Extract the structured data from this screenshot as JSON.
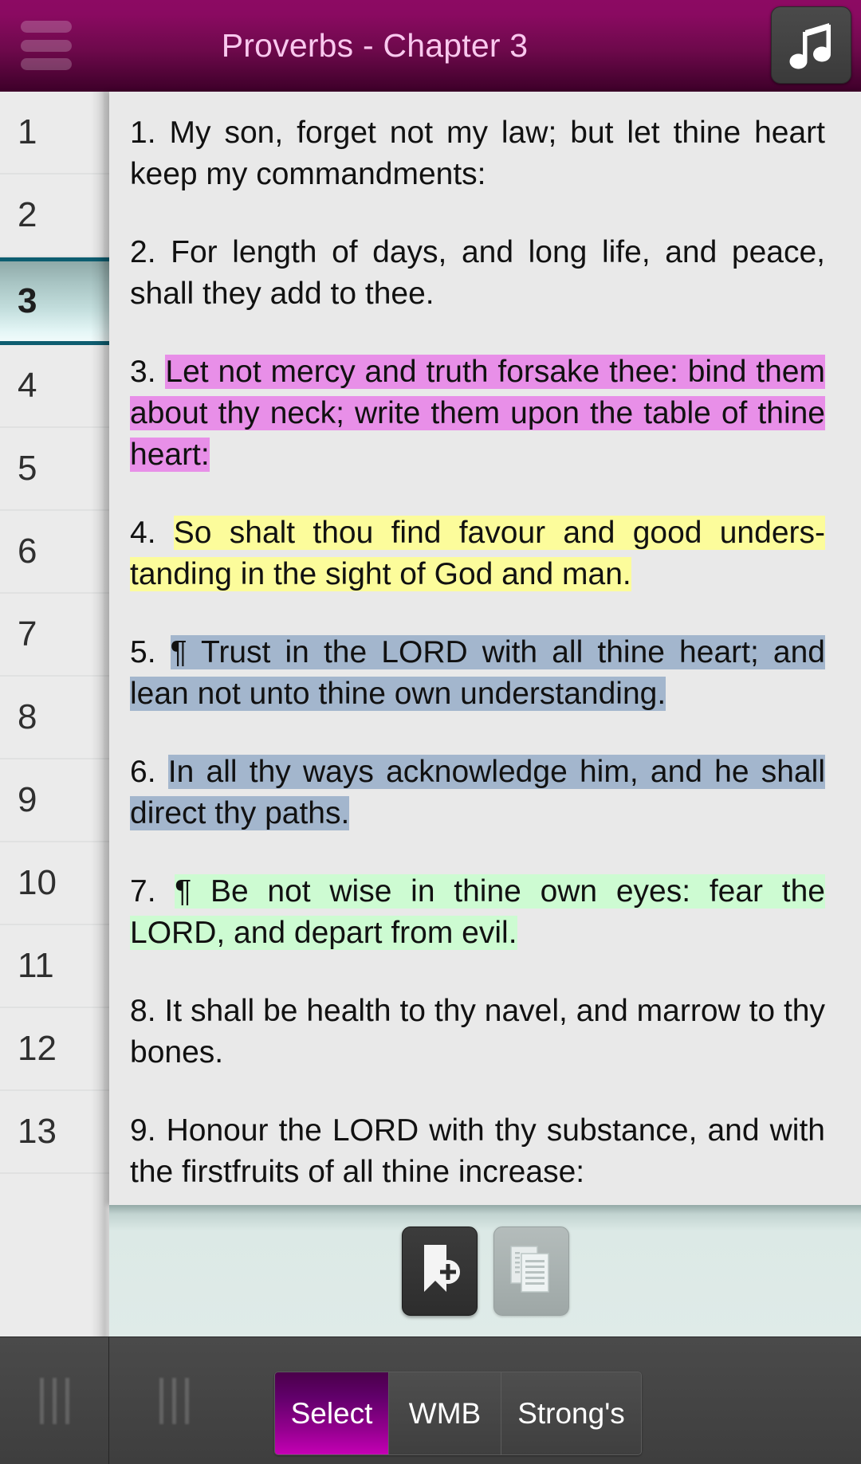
{
  "header": {
    "title": "Proverbs - Chapter 3",
    "menu_icon": "hamburger-menu-icon",
    "music_icon": "music-note-icon",
    "gradient_top": "#8c0a63",
    "gradient_bottom": "#3d0029",
    "title_color": "#f9c8ee"
  },
  "sidebar": {
    "selected_verse": "3",
    "items": [
      {
        "label": "1"
      },
      {
        "label": "2"
      },
      {
        "label": "3"
      },
      {
        "label": "4"
      },
      {
        "label": "5"
      },
      {
        "label": "6"
      },
      {
        "label": "7"
      },
      {
        "label": "8"
      },
      {
        "label": "9"
      },
      {
        "label": "10"
      },
      {
        "label": "11"
      },
      {
        "label": "12"
      },
      {
        "label": "13"
      }
    ]
  },
  "scripture": {
    "verses": [
      {
        "marker": "1. ",
        "text": "My son, forget not my law; but let thine heart keep my commandments:",
        "highlight": "none"
      },
      {
        "marker": "2. ",
        "text": "For length of days, and long life, and peace, shall they add to thee.",
        "highlight": "none"
      },
      {
        "marker": "3. ",
        "text": "Let not mercy and truth forsake thee: bind them about thy neck; write them upon the table of thine heart:",
        "highlight": "pink"
      },
      {
        "marker": "4. ",
        "text": "So shalt thou find favour and good unders-tanding in the sight of God and man.",
        "highlight": "yellow"
      },
      {
        "marker": "5. ",
        "text": "¶ Trust in the LORD with all thine heart; and lean not unto thine own understanding.",
        "highlight": "blue"
      },
      {
        "marker": "6. ",
        "text": "In all thy ways acknowledge him, and he shall direct thy paths.",
        "highlight": "blue"
      },
      {
        "marker": "7. ",
        "text": "¶ Be not wise in thine own eyes: fear the LORD, and depart from evil.",
        "highlight": "green"
      },
      {
        "marker": "8. ",
        "text": "It shall be health to thy navel, and marrow to thy bones.",
        "highlight": "none"
      },
      {
        "marker": "9. ",
        "text": "Honour the LORD with thy substance, and with the firstfruits of all thine increase:",
        "highlight": "none"
      }
    ],
    "highlight_colors": {
      "pink": "#e88fe8",
      "yellow": "#fcfc9b",
      "blue": "#a3b6cd",
      "green": "#cdfbd2"
    }
  },
  "action_bar": {
    "bookmark_icon": "bookmark-add-icon",
    "copy_icon": "copy-pages-icon"
  },
  "bottom_nav": {
    "grip_left_icon": "drag-handle-icon",
    "grip_right_icon": "drag-handle-icon",
    "segments": [
      {
        "label": "Select",
        "active": true
      },
      {
        "label": "WMB",
        "active": false
      },
      {
        "label": "Strong's",
        "active": false
      }
    ],
    "active_color": "#c400b4"
  }
}
